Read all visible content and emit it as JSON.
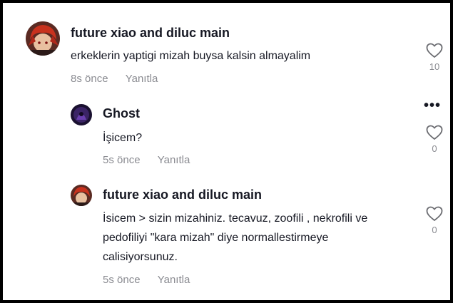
{
  "comments": [
    {
      "username": "future xiao and diluc main",
      "text": "erkeklerin yaptigi mizah buysa kalsin almayalim",
      "time": "8s önce",
      "reply_label": "Yanıtla",
      "likes": "10",
      "avatar": "red-haired-character-avatar"
    },
    {
      "username": "Ghost",
      "text": "İşicem?",
      "time": "5s önce",
      "reply_label": "Yanıtla",
      "likes": "0",
      "avatar": "dark-purple-avatar"
    },
    {
      "username": "future xiao and diluc main",
      "text": "İsicem > sizin mizahiniz. tecavuz, zoofili , nekrofili ve pedofiliyi \"kara mizah\" diye normallestirmeye calisiyorsunuz.",
      "time": "5s önce",
      "reply_label": "Yanıtla",
      "likes": "0",
      "avatar": "red-haired-character-avatar"
    }
  ],
  "more_options": "•••",
  "colors": {
    "text": "#161823",
    "muted": "#8a8b91"
  }
}
